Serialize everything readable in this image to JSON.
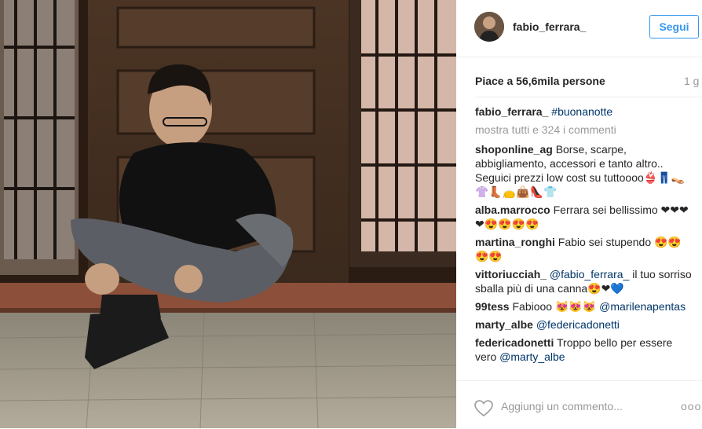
{
  "header": {
    "username": "fabio_ferrara_",
    "follow_label": "Segui"
  },
  "likes": "Piace a 56,6mila persone",
  "time": "1 g",
  "caption": {
    "user": "fabio_ferrara_",
    "text": "#buonanotte"
  },
  "view_all": "mostra tutti e 324 i commenti",
  "comments": [
    {
      "user": "shoponline_ag",
      "text": "Borse, scarpe, abbigliamento, accessori e tanto altro.. Seguici prezzi low cost su tuttoooo👙👖👡👚👢👝👜👠👕"
    },
    {
      "user": "alba.marrocco",
      "text": "Ferrara sei bellissimo ❤❤❤❤😍😍😍😍"
    },
    {
      "user": "martina_ronghi",
      "text": "Fabio sei stupendo 😍😍😍😍"
    },
    {
      "user": "vittoriucciah_",
      "mention": "@fabio_ferrara_",
      "text": "il tuo sorriso sballa più di una canna😍❤💙"
    },
    {
      "user": "99tess",
      "text": "Fabiooo 😻😻😻",
      "mention": "@marilenapentas"
    },
    {
      "user": "marty_albe",
      "mention": "@federicadonetti"
    },
    {
      "user": "federicadonetti",
      "text": "Troppo bello per essere vero",
      "mention": "@marty_albe"
    }
  ],
  "footer": {
    "add_comment_placeholder": "Aggiungi un commento...",
    "more_label": "ooo"
  }
}
